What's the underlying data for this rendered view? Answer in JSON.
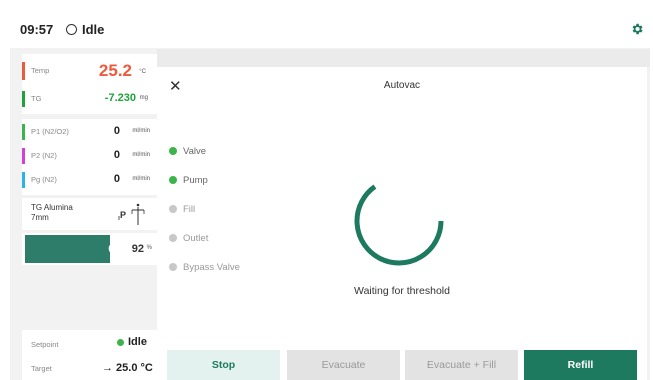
{
  "topbar": {
    "time": "09:57",
    "status": "Idle"
  },
  "readings": {
    "temp": {
      "label": "Temp",
      "value": "25.2",
      "unit": "°C",
      "color": "#ef5a3c"
    },
    "tg": {
      "label": "TG",
      "value": "-7.230",
      "unit": "mg",
      "color": "#1fa33a"
    }
  },
  "flows": [
    {
      "label": "P1 (N2/O2)",
      "value": "0",
      "unit": "ml/min",
      "color": "#3cb44b"
    },
    {
      "label": "P2 (N2)",
      "value": "0",
      "unit": "ml/min",
      "color": "#d63fd6"
    },
    {
      "label": "Pg (N2)",
      "value": "0",
      "unit": "ml/min",
      "color": "#29b6e6"
    }
  ],
  "crucible": {
    "title_line1": "TG Alumina",
    "title_line2": "7mm",
    "icon": "balance-p-icon"
  },
  "progress": {
    "value": "92",
    "unit": "%",
    "fraction": 0.65
  },
  "setpoint": {
    "label": "Setpoint",
    "status": "Idle",
    "target_label": "Target",
    "target_value": "→ 25.0 °C"
  },
  "dialog": {
    "title": "Autovac",
    "steps": [
      {
        "label": "Valve",
        "active": true
      },
      {
        "label": "Pump",
        "active": true
      },
      {
        "label": "Fill",
        "active": false
      },
      {
        "label": "Outlet",
        "active": false
      },
      {
        "label": "Bypass Valve",
        "active": false
      }
    ],
    "waiting_text": "Waiting for threshold",
    "buttons": {
      "stop": "Stop",
      "evacuate": "Evacuate",
      "evacuate_fill": "Evacuate + Fill",
      "refill": "Refill"
    }
  },
  "colors": {
    "accent": "#1e7a5e",
    "active_dot": "#3cb44b",
    "inactive_dot": "#c8c8c8"
  }
}
